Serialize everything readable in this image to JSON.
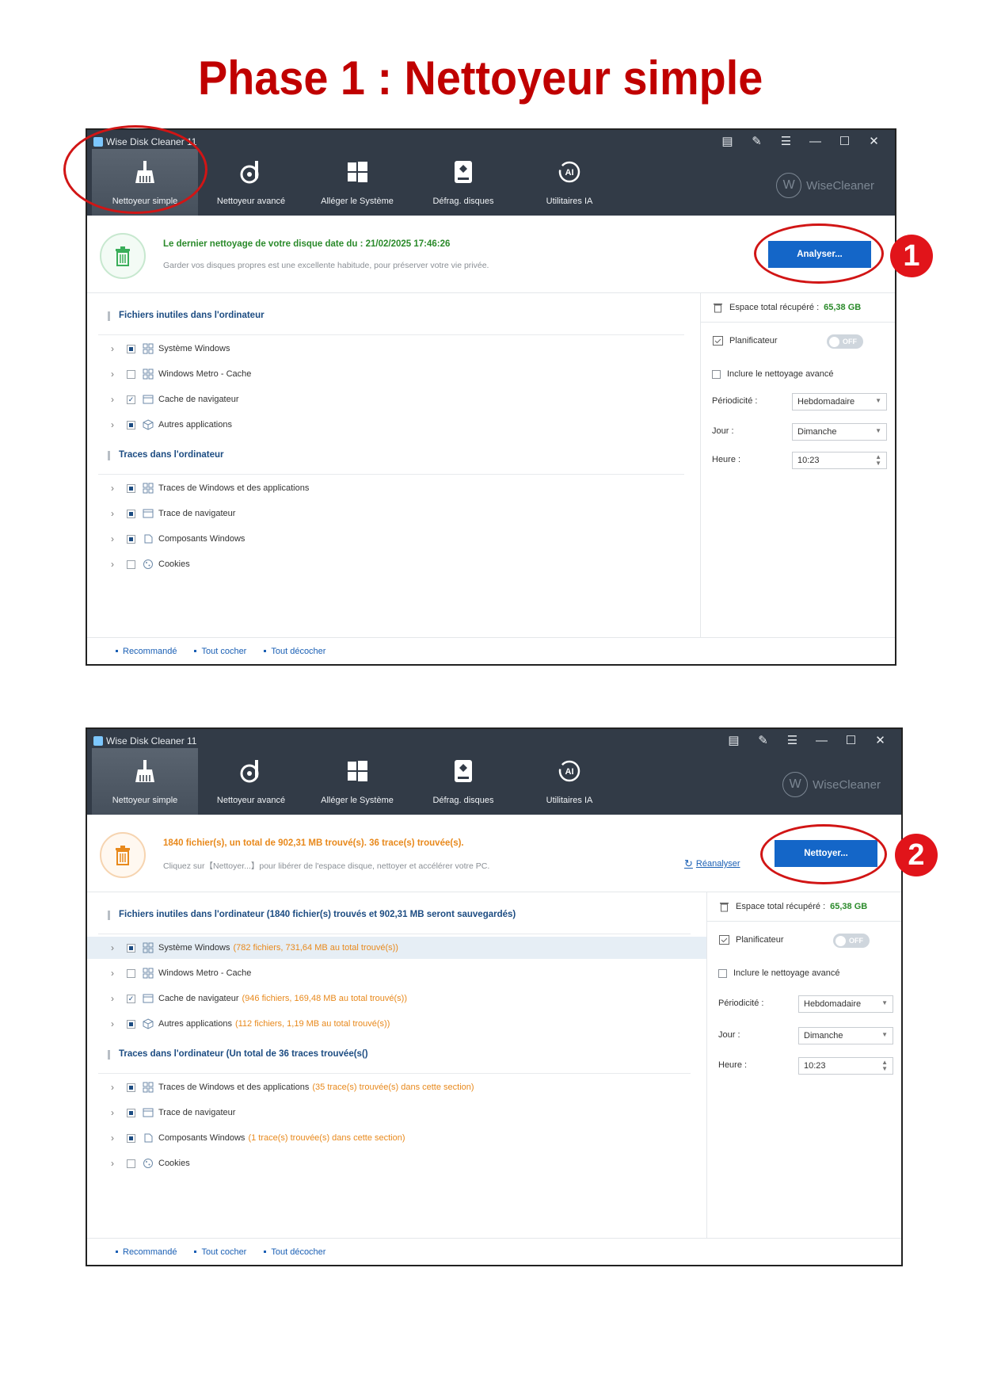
{
  "page": {
    "title": "Phase 1 : Nettoyeur simple",
    "step1": "1",
    "step2": "2"
  },
  "colors": {
    "title_red": "#c00000",
    "titlebar": "#323b47",
    "primary_button": "#1466c8",
    "green_text": "#2a8a2a",
    "orange_text": "#e8891c",
    "link_blue": "#1a5fb4",
    "section_blue": "#1c4c82"
  },
  "app": {
    "window_title": "Wise Disk Cleaner 11",
    "brand": "WiseCleaner",
    "brand_mark": "W",
    "tabs": [
      {
        "label": "Nettoyeur simple",
        "icon": "broom-icon"
      },
      {
        "label": "Nettoyeur avancé",
        "icon": "advanced-clean-icon"
      },
      {
        "label": "Alléger le Système",
        "icon": "windows-icon"
      },
      {
        "label": "Défrag. disques",
        "icon": "disk-icon"
      },
      {
        "label": "Utilitaires IA",
        "icon": "ai-icon"
      }
    ],
    "controls": [
      "feedback-icon",
      "edit-icon",
      "menu-icon",
      "minimize-icon",
      "maximize-icon",
      "close-icon"
    ]
  },
  "screen1": {
    "banner_main": "Le dernier nettoyage de votre disque date du : 21/02/2025 17:46:26",
    "banner_sub": "Garder vos disques propres est une excellente habitude, pour préserver votre vie privée.",
    "action_button": "Analyser...",
    "section1": "Fichiers inutiles dans l'ordinateur",
    "section2": "Traces dans l'ordinateur",
    "items1": [
      {
        "label": "Système Windows",
        "detail": "",
        "check": "partial"
      },
      {
        "label": "Windows Metro - Cache",
        "detail": "",
        "check": "none"
      },
      {
        "label": "Cache de navigateur",
        "detail": "",
        "check": "checked"
      },
      {
        "label": "Autres applications",
        "detail": "",
        "check": "partial"
      }
    ],
    "items2": [
      {
        "label": "Traces de Windows et des applications",
        "detail": "",
        "check": "partial"
      },
      {
        "label": "Trace de navigateur",
        "detail": "",
        "check": "partial"
      },
      {
        "label": "Composants Windows",
        "detail": "",
        "check": "partial"
      },
      {
        "label": "Cookies",
        "detail": "",
        "check": "none"
      }
    ]
  },
  "screen2": {
    "banner_main": "1840 fichier(s), un total de 902,31 MB trouvé(s). 36 trace(s) trouvée(s).",
    "banner_sub": "Cliquez sur【Nettoyer...】pour libérer de l'espace disque, nettoyer et accélérer votre PC.",
    "reanalyse": "Réanalyser",
    "action_button": "Nettoyer...",
    "section1": "Fichiers inutiles dans l'ordinateur  (1840 fichier(s) trouvés et 902,31 MB seront sauvegardés)",
    "section2": "Traces dans l'ordinateur  (Un total de 36 traces trouvée(s()",
    "items1": [
      {
        "label": "Système Windows",
        "detail": "(782 fichiers, 731,64 MB au total trouvé(s))",
        "check": "partial"
      },
      {
        "label": "Windows Metro - Cache",
        "detail": "",
        "check": "none"
      },
      {
        "label": "Cache de navigateur",
        "detail": "(946 fichiers, 169,48 MB au total trouvé(s))",
        "check": "checked"
      },
      {
        "label": "Autres applications",
        "detail": "(112 fichiers, 1,19 MB au total trouvé(s))",
        "check": "partial"
      }
    ],
    "items2": [
      {
        "label": "Traces de Windows et des applications",
        "detail": "(35 trace(s) trouvée(s) dans cette section)",
        "check": "partial"
      },
      {
        "label": "Trace de navigateur",
        "detail": "",
        "check": "partial"
      },
      {
        "label": "Composants Windows",
        "detail": "(1 trace(s) trouvée(s) dans cette section)",
        "check": "partial"
      },
      {
        "label": "Cookies",
        "detail": "",
        "check": "none"
      }
    ]
  },
  "sidebar": {
    "space_label": "Espace total récupéré :",
    "space_value": "65,38 GB",
    "scheduler_label": "Planificateur",
    "scheduler_state": "OFF",
    "include_advanced": "Inclure le nettoyage avancé",
    "period_label": "Périodicité :",
    "period_value": "Hebdomadaire",
    "day_label": "Jour :",
    "day_value": "Dimanche",
    "hour_label": "Heure :",
    "hour_value": "10:23"
  },
  "footer": {
    "recommended": "Recommandé",
    "check_all": "Tout cocher",
    "uncheck_all": "Tout décocher"
  }
}
